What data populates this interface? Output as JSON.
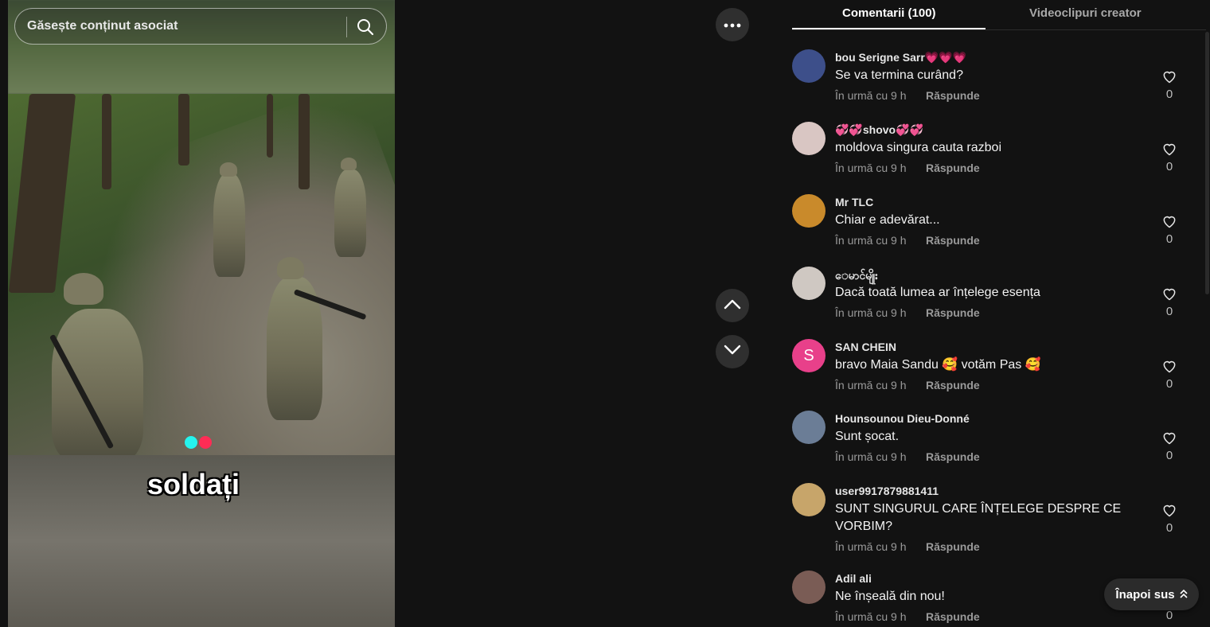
{
  "search": {
    "placeholder": "Găsește conținut asociat"
  },
  "video": {
    "caption": "soldați"
  },
  "tabs": [
    {
      "label": "Comentarii (100)",
      "active": true
    },
    {
      "label": "Videoclipuri creator",
      "active": false
    }
  ],
  "comments": [
    {
      "user": "bou Serigne Sarr💗💗💗",
      "text": "Se va termina curând?",
      "time": "În urmă cu 9 h",
      "reply": "Răspunde",
      "likes": "0",
      "avatar_color": "#3d4f8a"
    },
    {
      "user": "💞💞shovo💞💞",
      "text": "moldova singura cauta razboi",
      "time": "În urmă cu 9 h",
      "reply": "Răspunde",
      "likes": "0",
      "avatar_color": "#d9c6c3"
    },
    {
      "user": "Mr TLC",
      "text": "Chiar e adevărat...",
      "time": "În urmă cu 9 h",
      "reply": "Răspunde",
      "likes": "0",
      "avatar_color": "#c98a2b"
    },
    {
      "user": "ေမာင်မျိုး",
      "text": "Dacă toată lumea ar înțelege esența",
      "time": "În urmă cu 9 h",
      "reply": "Răspunde",
      "likes": "0",
      "avatar_color": "#cfc8c2"
    },
    {
      "user": "SAN CHEIN",
      "text": "bravo Maia Sandu 🥰 votăm Pas 🥰",
      "time": "În urmă cu 9 h",
      "reply": "Răspunde",
      "likes": "0",
      "avatar_color": "#e8408a",
      "avatar_letter": "S"
    },
    {
      "user": "Hounsounou Dieu-Donné",
      "text": "Sunt șocat.",
      "time": "În urmă cu 9 h",
      "reply": "Răspunde",
      "likes": "0",
      "avatar_color": "#6b7d96"
    },
    {
      "user": "user9917879881411",
      "text": "SUNT SINGURUL CARE ÎNȚELEGE DESPRE CE VORBIM?",
      "time": "În urmă cu 9 h",
      "reply": "Răspunde",
      "likes": "0",
      "avatar_color": "#c7a56a"
    },
    {
      "user": "Adil ali",
      "text": "Ne înșeală din nou!",
      "time": "În urmă cu 9 h",
      "reply": "Răspunde",
      "likes": "0",
      "avatar_color": "#7a5c55"
    }
  ],
  "back_to_top": {
    "label": "Înapoi sus"
  },
  "icons": {
    "search": "search-icon",
    "more": "more-icon",
    "up": "chevron-up-icon",
    "down": "chevron-down-icon",
    "like": "heart-icon",
    "back": "double-chevron-up-icon"
  },
  "colors": {
    "accent_cyan": "#25f4ee",
    "accent_red": "#fe2c55"
  }
}
